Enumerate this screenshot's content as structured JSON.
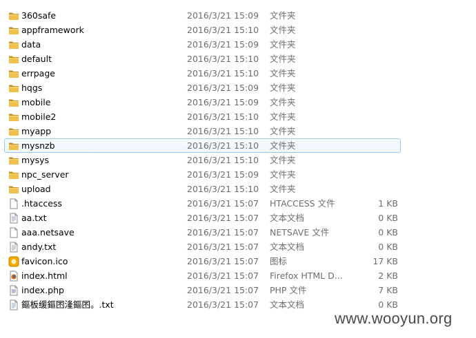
{
  "files": [
    {
      "name": "360safe",
      "date": "2016/3/21 15:09",
      "type": "文件夹",
      "size": "",
      "icon": "folder-icon"
    },
    {
      "name": "appframework",
      "date": "2016/3/21 15:10",
      "type": "文件夹",
      "size": "",
      "icon": "folder-icon"
    },
    {
      "name": "data",
      "date": "2016/3/21 15:09",
      "type": "文件夹",
      "size": "",
      "icon": "folder-icon"
    },
    {
      "name": "default",
      "date": "2016/3/21 15:10",
      "type": "文件夹",
      "size": "",
      "icon": "folder-icon"
    },
    {
      "name": "errpage",
      "date": "2016/3/21 15:10",
      "type": "文件夹",
      "size": "",
      "icon": "folder-icon"
    },
    {
      "name": "hqgs",
      "date": "2016/3/21 15:09",
      "type": "文件夹",
      "size": "",
      "icon": "folder-icon"
    },
    {
      "name": "mobile",
      "date": "2016/3/21 15:09",
      "type": "文件夹",
      "size": "",
      "icon": "folder-icon"
    },
    {
      "name": "mobile2",
      "date": "2016/3/21 15:10",
      "type": "文件夹",
      "size": "",
      "icon": "folder-icon"
    },
    {
      "name": "myapp",
      "date": "2016/3/21 15:10",
      "type": "文件夹",
      "size": "",
      "icon": "folder-icon"
    },
    {
      "name": "mysnzb",
      "date": "2016/3/21 15:10",
      "type": "文件夹",
      "size": "",
      "icon": "folder-icon",
      "selected": true
    },
    {
      "name": "mysys",
      "date": "2016/3/21 15:10",
      "type": "文件夹",
      "size": "",
      "icon": "folder-icon"
    },
    {
      "name": "npc_server",
      "date": "2016/3/21 15:09",
      "type": "文件夹",
      "size": "",
      "icon": "folder-icon"
    },
    {
      "name": "upload",
      "date": "2016/3/21 15:10",
      "type": "文件夹",
      "size": "",
      "icon": "folder-icon"
    },
    {
      "name": ".htaccess",
      "date": "2016/3/21 15:07",
      "type": "HTACCESS 文件",
      "size": "1 KB",
      "icon": "blank-file-icon"
    },
    {
      "name": "aa.txt",
      "date": "2016/3/21 15:07",
      "type": "文本文档",
      "size": "0 KB",
      "icon": "text-file-icon"
    },
    {
      "name": "aaa.netsave",
      "date": "2016/3/21 15:07",
      "type": "NETSAVE 文件",
      "size": "0 KB",
      "icon": "blank-file-icon"
    },
    {
      "name": "andy.txt",
      "date": "2016/3/21 15:07",
      "type": "文本文档",
      "size": "0 KB",
      "icon": "text-file-icon"
    },
    {
      "name": "favicon.ico",
      "date": "2016/3/21 15:07",
      "type": "图标",
      "size": "17 KB",
      "icon": "favicon-icon"
    },
    {
      "name": "index.html",
      "date": "2016/3/21 15:07",
      "type": "Firefox HTML D...",
      "size": "2 KB",
      "icon": "firefox-html-icon"
    },
    {
      "name": "index.php",
      "date": "2016/3/21 15:07",
      "type": "PHP 文件",
      "size": "7 KB",
      "icon": "php-file-icon"
    },
    {
      "name": "鏂板缓鏂囨湰鏂囨。.txt",
      "date": "2016/3/21 15:07",
      "type": "文本文档",
      "size": "0 KB",
      "icon": "text-file-icon"
    }
  ],
  "watermark": "www.wooyun.org",
  "colors": {
    "folder": "#e8b53a",
    "folder_dark": "#c98f1c",
    "selection_border": "#99c9ef",
    "secondary_text": "#6d6d6d"
  }
}
